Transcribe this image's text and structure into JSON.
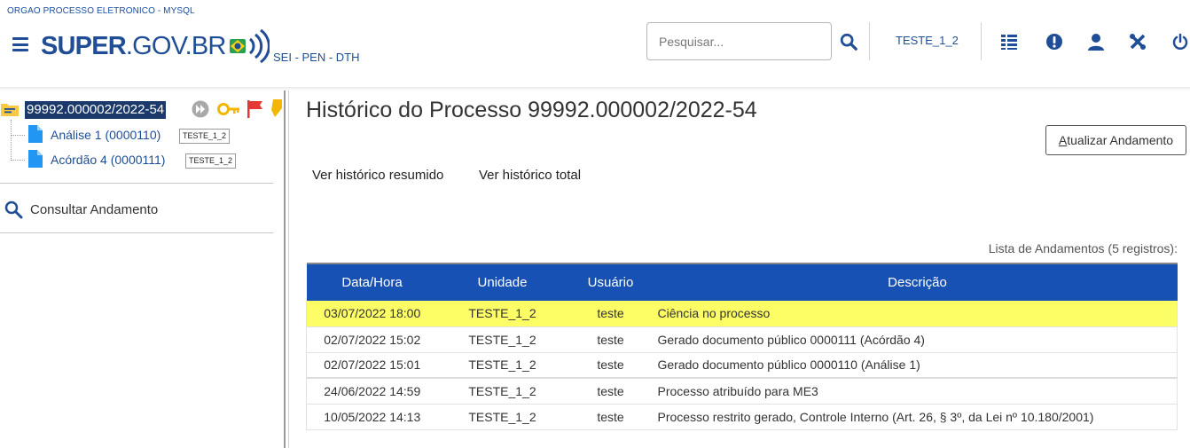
{
  "header": {
    "org_name": "ORGAO PROCESSO ELETRONICO - MYSQL",
    "logo_text_bold": "SUPER",
    "logo_text_light": ".GOV.BR",
    "env_label": "SEI - PEN - DTH",
    "search_placeholder": "Pesquisar...",
    "unit_label": "TESTE_1_2",
    "icons": [
      "menu-icon",
      "search-icon",
      "control-panel-icon",
      "alert-icon",
      "user-icon",
      "tools-icon",
      "power-icon"
    ],
    "brand_color": "#1f4e96"
  },
  "tree": {
    "process_number": "99992.000002/2022-54",
    "documents": [
      {
        "label": "Análise 1 (0000110)",
        "unit": "TESTE_1_2"
      },
      {
        "label": "Acórdão 4 (0000111)",
        "unit": "TESTE_1_2"
      }
    ],
    "consult_label": "Consultar Andamento"
  },
  "main": {
    "title": "Histórico do Processo 99992.000002/2022-54",
    "update_button_first": "A",
    "update_button_rest": "tualizar Andamento",
    "view_summary": "Ver histórico resumido",
    "view_total": "Ver histórico total",
    "caption": "Lista de Andamentos (5 registros):",
    "columns": [
      "Data/Hora",
      "Unidade",
      "Usuário",
      "Descrição"
    ],
    "rows": [
      {
        "date": "03/07/2022 18:00",
        "unit": "TESTE_1_2",
        "user": "teste",
        "desc": "Ciência no processo"
      },
      {
        "date": "02/07/2022 15:02",
        "unit": "TESTE_1_2",
        "user": "teste",
        "desc": "Gerado documento público 0000111 (Acórdão 4)"
      },
      {
        "date": "02/07/2022 15:01",
        "unit": "TESTE_1_2",
        "user": "teste",
        "desc": "Gerado documento público 0000110 (Análise 1)"
      },
      {
        "date": "24/06/2022 14:59",
        "unit": "TESTE_1_2",
        "user": "teste",
        "desc": "Processo atribuído para ME3"
      },
      {
        "date": "10/05/2022 14:13",
        "unit": "TESTE_1_2",
        "user": "teste",
        "desc": "Processo restrito gerado, Controle Interno (Art. 26, § 3º, da Lei nº 10.180/2001)"
      }
    ],
    "header_color": "#1851b4",
    "highlight_color": "#fdfd66"
  }
}
